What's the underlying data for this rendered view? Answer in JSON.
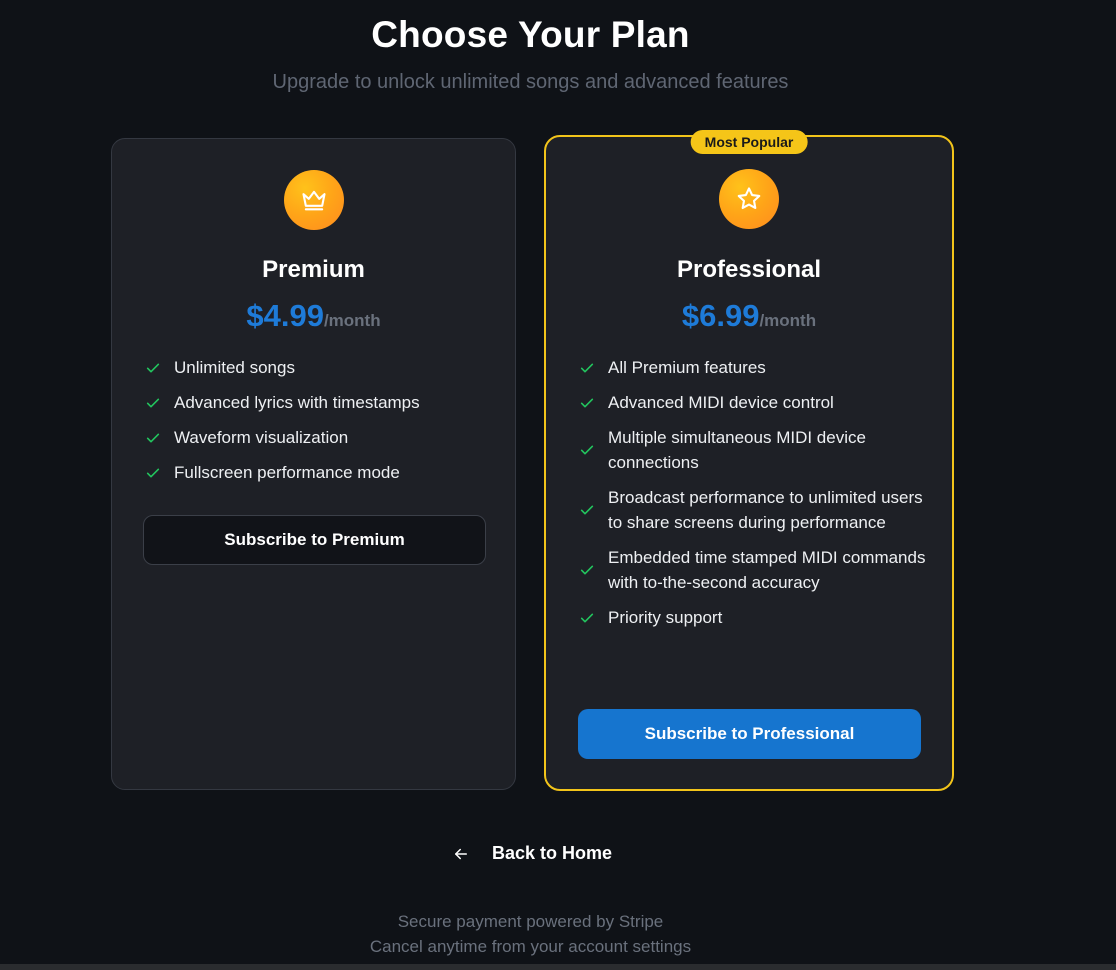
{
  "header": {
    "title": "Choose Your Plan",
    "subtitle": "Upgrade to unlock unlimited songs and advanced features"
  },
  "plans": [
    {
      "icon": "crown-icon",
      "name": "Premium",
      "price": "$4.99",
      "period": "/month",
      "features": [
        "Unlimited songs",
        "Advanced lyrics with timestamps",
        "Waveform visualization",
        "Fullscreen performance mode"
      ],
      "button_label": "Subscribe to Premium"
    },
    {
      "badge": "Most Popular",
      "icon": "star-icon",
      "name": "Professional",
      "price": "$6.99",
      "period": "/month",
      "features": [
        "All Premium features",
        "Advanced MIDI device control",
        "Multiple simultaneous MIDI device connections",
        "Broadcast performance to unlimited users to share screens during performance",
        "Embedded time stamped MIDI commands with to-the-second accuracy",
        "Priority support"
      ],
      "button_label": "Subscribe to Professional"
    }
  ],
  "nav": {
    "back_label": "Back to Home",
    "back_icon": "arrow-left-icon"
  },
  "footer": {
    "line1": "Secure payment powered by Stripe",
    "line2": "Cancel anytime from your account settings"
  },
  "colors": {
    "background": "#0f1217",
    "card": "#1e2026",
    "accent_blue": "#1675cf",
    "price_blue": "#1e7bd8",
    "highlight_gold": "#f2c41a",
    "check_green": "#22c55e"
  }
}
